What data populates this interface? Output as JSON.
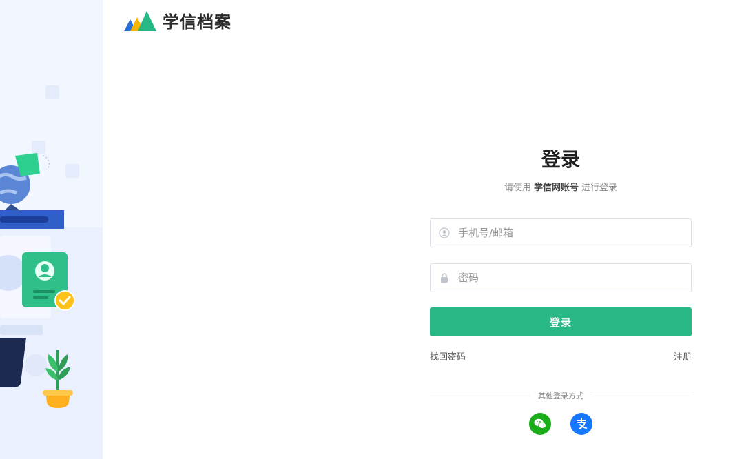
{
  "brand": {
    "name": "学信档案"
  },
  "login": {
    "title": "登录",
    "subtitle_prefix": "请使用",
    "subtitle_account": "学信网账号",
    "subtitle_suffix": "进行登录",
    "username_placeholder": "手机号/邮箱",
    "password_placeholder": "密码",
    "submit_label": "登录",
    "forgot_password": "找回密码",
    "register": "注册",
    "other_methods": "其他登录方式"
  },
  "social": [
    {
      "name": "wechat",
      "icon": "wechat-icon",
      "color": "#1aad19"
    },
    {
      "name": "alipay",
      "icon": "alipay-icon",
      "color": "#1677ff"
    }
  ],
  "colors": {
    "accent": "#27b885",
    "panel_bg": "#f2f6ff"
  }
}
